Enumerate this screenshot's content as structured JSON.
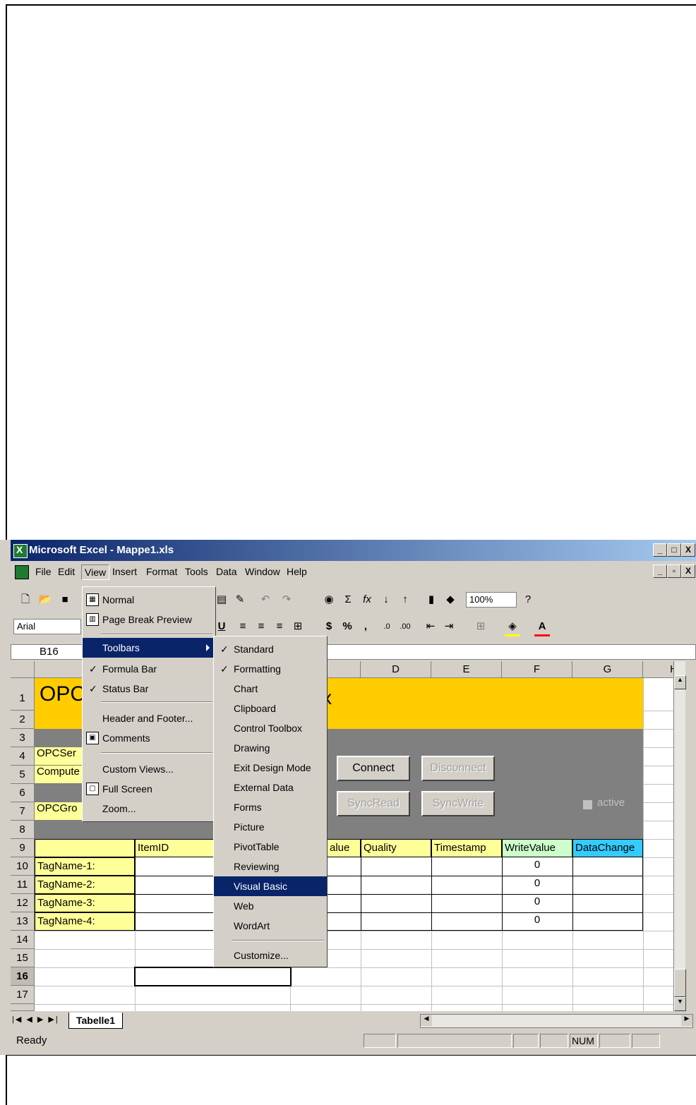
{
  "window": {
    "title": "Microsoft Excel - Mappe1.xls",
    "controls": [
      "_",
      "□",
      "X"
    ],
    "doc_controls": [
      "_",
      "▫",
      "X"
    ]
  },
  "menubar": [
    "File",
    "Edit",
    "View",
    "Insert",
    "Format",
    "Tools",
    "Data",
    "Window",
    "Help"
  ],
  "toolbar": {
    "zoom": "100%",
    "font": "Arial"
  },
  "namebox": "B16",
  "columns": [
    "D",
    "E",
    "F",
    "G",
    "H"
  ],
  "rows": [
    "1",
    "2",
    "3",
    "4",
    "5",
    "6",
    "7",
    "8",
    "9",
    "10",
    "11",
    "12",
    "13",
    "14",
    "15",
    "16",
    "17"
  ],
  "sheet": {
    "title_partial": "OPC",
    "title_tail": "x",
    "labels": [
      "OPCSer",
      "Compute",
      "OPCGro"
    ],
    "buttons": {
      "connect": "Connect",
      "disconnect": "Disconnect",
      "syncread": "SyncRead",
      "syncwrite": "SyncWrite"
    },
    "active_label": "active",
    "headers": {
      "itemid": "ItemID",
      "value": "alue",
      "quality": "Quality",
      "timestamp": "Timestamp",
      "writevalue": "WriteValue",
      "datachange": "DataChange"
    },
    "tags": [
      "TagName-1:",
      "TagName-2:",
      "TagName-3:",
      "TagName-4:"
    ],
    "write_values": [
      "0",
      "0",
      "0",
      "0"
    ]
  },
  "view_menu": {
    "items": [
      "Normal",
      "Page Break Preview",
      "Toolbars",
      "Formula Bar",
      "Status Bar",
      "Header and Footer...",
      "Comments",
      "Custom Views...",
      "Full Screen",
      "Zoom..."
    ]
  },
  "toolbars_submenu": {
    "items": [
      "Standard",
      "Formatting",
      "Chart",
      "Clipboard",
      "Control Toolbox",
      "Drawing",
      "Exit Design Mode",
      "External Data",
      "Forms",
      "Picture",
      "PivotTable",
      "Reviewing",
      "Visual Basic",
      "Web",
      "WordArt",
      "Customize..."
    ],
    "highlighted": "Visual Basic"
  },
  "sheet_tab": "Tabelle1",
  "status": {
    "text": "Ready",
    "num": "NUM"
  },
  "colors": {
    "title_yellow": "#ffcc00",
    "band_gray": "#808080",
    "label_yellow": "#ffff99",
    "writevalue_bg": "#ccffcc",
    "datachange_bg": "#33ccff",
    "highlight": "#0a246a"
  }
}
